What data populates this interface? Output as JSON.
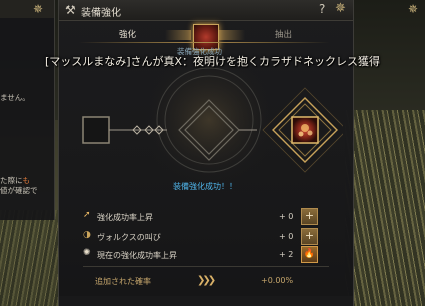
{
  "window": {
    "title": "装備強化",
    "tabs": [
      "強化",
      "抽出"
    ],
    "success_small": "装備強化成功",
    "success_text": "装備強化成功！！"
  },
  "stats": [
    {
      "label": "強化成功率上昇",
      "value": "+ 0",
      "button": "+"
    },
    {
      "label": "ヴォルクスの叫び",
      "value": "+ 0",
      "button": "+"
    },
    {
      "label": "現在の強化成功率上昇",
      "value": "+ 2",
      "button": "fire"
    }
  ],
  "added": {
    "label": "追加された確率",
    "value": "+0.00%"
  },
  "announcement": "[マッスルまなみ]さんが真Ⅹ：夜明けを抱くカラザドネックレス獲得",
  "left_panel": {
    "line1": "ません。",
    "line2_a": "た際に",
    "line2_b": "も",
    "line3_a": "値",
    "line3_b": "が確認で"
  },
  "colors": {
    "accent_gold": "#c9a35a",
    "success_blue": "#4fb3e8"
  }
}
